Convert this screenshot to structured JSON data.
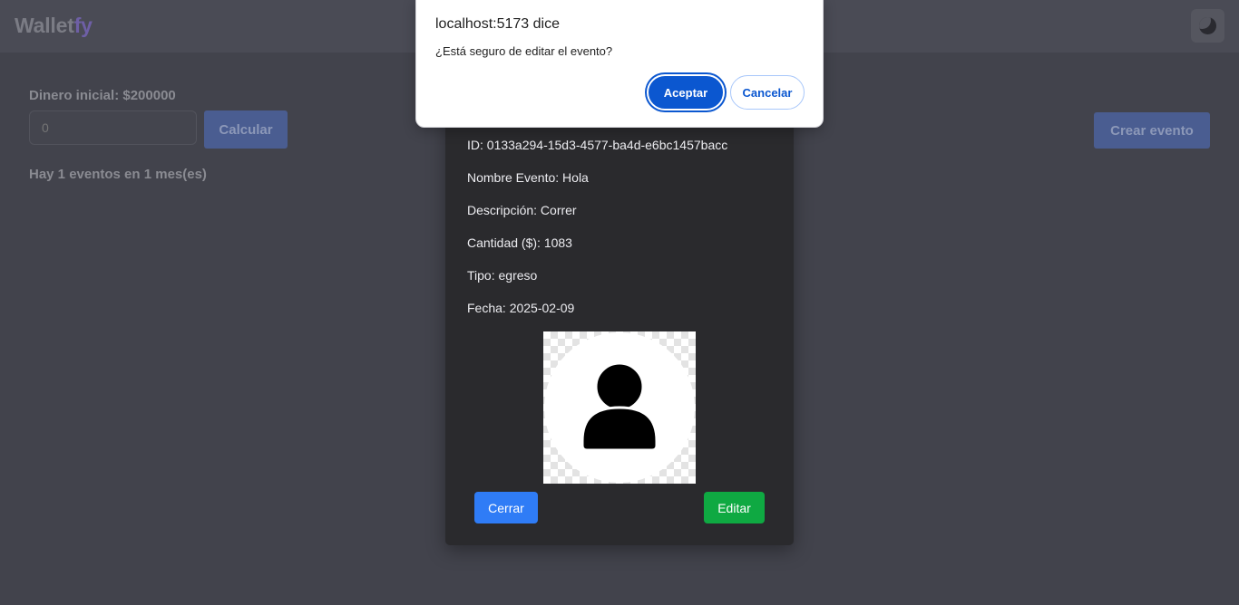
{
  "header": {
    "logo_main": "Wallet",
    "logo_accent": "fy"
  },
  "left_panel": {
    "money_label": "Dinero inicial: $200000",
    "money_input_placeholder": "0",
    "calc_button": "Calcular",
    "events_count": "Hay 1 eventos en 1 mes(es)"
  },
  "right_panel": {
    "create_button": "Crear evento"
  },
  "event_modal": {
    "id": "ID: 0133a294-15d3-4577-ba4d-e6bc1457bacc",
    "name": "Nombre Evento: Hola",
    "description": "Descripción: Correr",
    "amount": "Cantidad ($): 1083",
    "type": "Tipo: egreso",
    "date": "Fecha: 2025-02-09",
    "close_button": "Cerrar",
    "edit_button": "Editar"
  },
  "dialog": {
    "title": "localhost:5173 dice",
    "message": "¿Está seguro de editar el evento?",
    "accept_button": "Aceptar",
    "cancel_button": "Cancelar"
  },
  "colors": {
    "background": "#42434c",
    "modal": "#2a2a2d",
    "close_button": "#2f7cf6",
    "edit_button": "#0fa942",
    "dialog_accent": "#0b57d0"
  }
}
